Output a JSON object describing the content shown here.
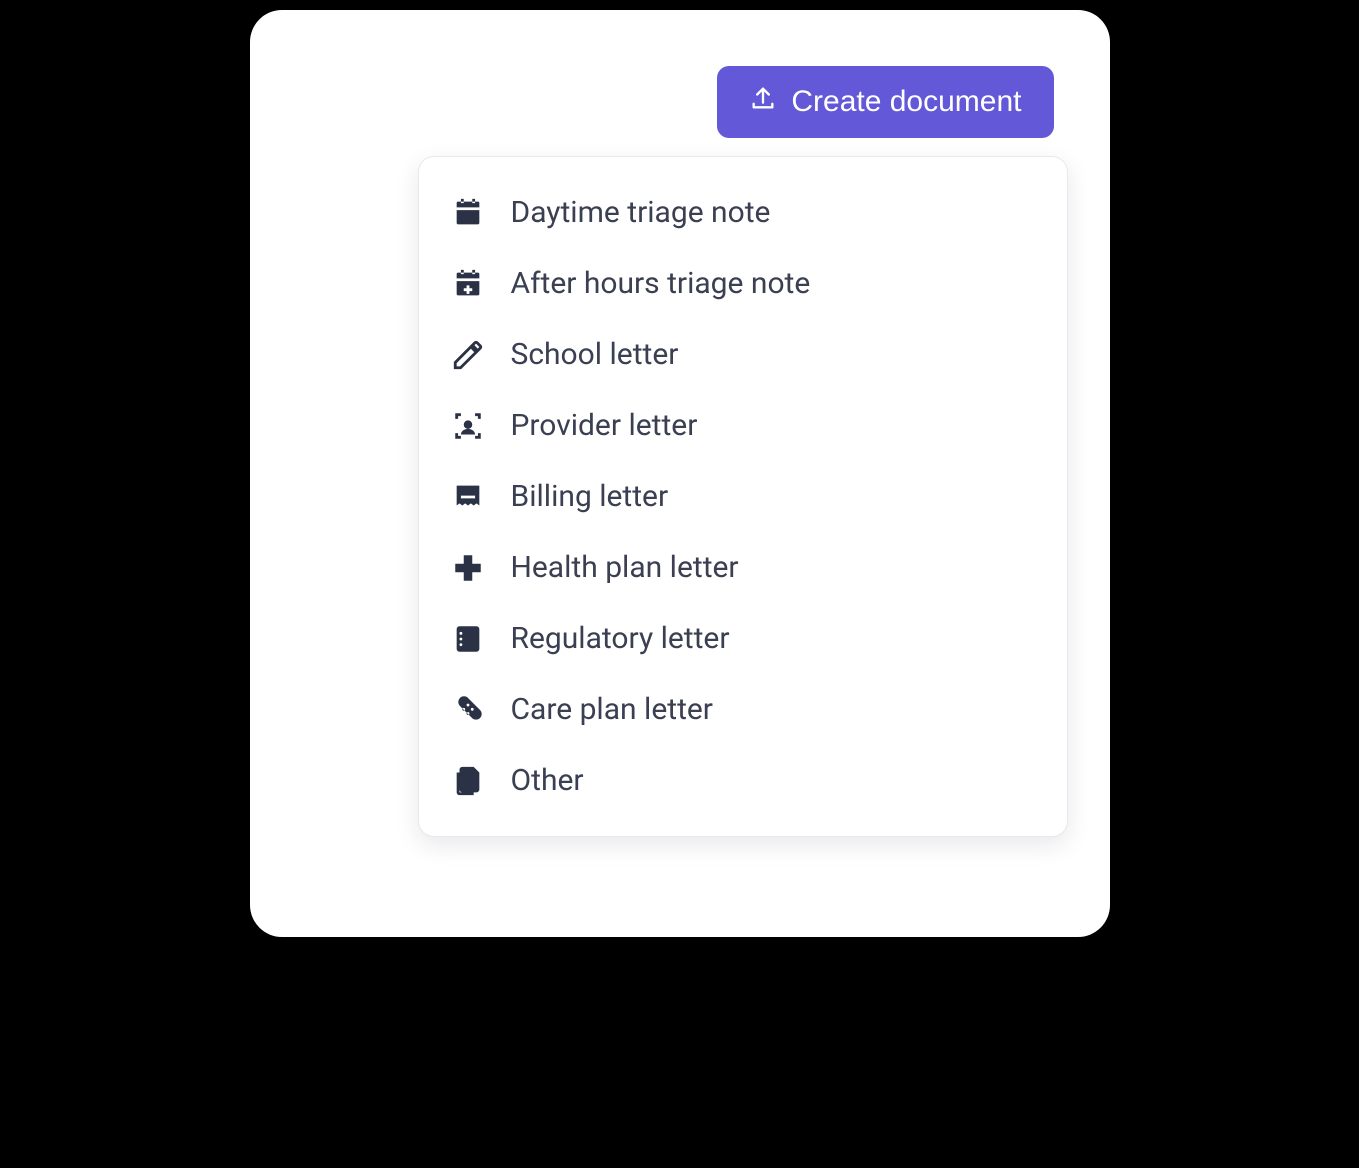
{
  "button": {
    "label": "Create document"
  },
  "menu": {
    "items": [
      {
        "label": "Daytime triage note",
        "icon": "calendar-icon"
      },
      {
        "label": "After hours triage note",
        "icon": "calendar-plus-icon"
      },
      {
        "label": "School letter",
        "icon": "pencil-icon"
      },
      {
        "label": "Provider letter",
        "icon": "person-frame-icon"
      },
      {
        "label": "Billing letter",
        "icon": "receipt-icon"
      },
      {
        "label": "Health plan letter",
        "icon": "medical-cross-icon"
      },
      {
        "label": "Regulatory letter",
        "icon": "clipboard-icon"
      },
      {
        "label": "Care plan letter",
        "icon": "bandage-icon"
      },
      {
        "label": "Other",
        "icon": "documents-icon"
      }
    ]
  },
  "colors": {
    "accent": "#6258d8",
    "text": "#3a4052",
    "icon": "#2b3246"
  }
}
